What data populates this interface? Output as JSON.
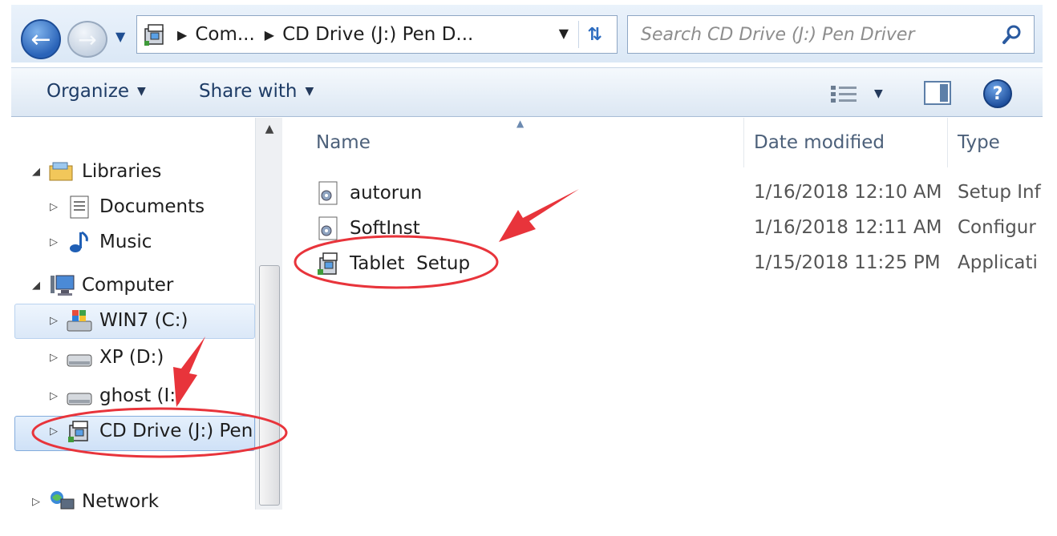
{
  "address_bar": {
    "crumbs": [
      "Com...",
      "CD Drive (J:) Pen D..."
    ],
    "search_placeholder": "Search CD Drive (J:) Pen Driver"
  },
  "toolbar": {
    "organize_label": "Organize",
    "share_label": "Share with"
  },
  "nav_pane": {
    "items": [
      {
        "label": "Libraries",
        "icon": "libraries-icon"
      },
      {
        "label": "Documents",
        "icon": "documents-icon"
      },
      {
        "label": "Music",
        "icon": "music-icon"
      },
      {
        "label": "Computer",
        "icon": "computer-icon"
      },
      {
        "label": "WIN7 (C:)",
        "icon": "windows-drive-icon"
      },
      {
        "label": "XP (D:)",
        "icon": "hard-drive-icon"
      },
      {
        "label": "ghost (I:)",
        "icon": "hard-drive-icon"
      },
      {
        "label": "CD Drive (J:) Pen",
        "icon": "cd-drive-icon"
      },
      {
        "label": "Network",
        "icon": "network-icon"
      }
    ]
  },
  "file_list": {
    "columns": [
      "Name",
      "Date modified",
      "Type"
    ],
    "rows": [
      {
        "name": "autorun",
        "date": "1/16/2018 12:10 AM",
        "type": "Setup Inf",
        "icon": "settings-file-icon"
      },
      {
        "name": "SoftInst",
        "date": "1/16/2018 12:11 AM",
        "type": "Configur",
        "icon": "settings-file-icon"
      },
      {
        "name": "Tablet  Setup",
        "date": "1/15/2018 11:25 PM",
        "type": "Applicati",
        "icon": "setup-app-icon"
      }
    ]
  },
  "colors": {
    "annotation_red": "#e8343b",
    "accent_blue": "#2a63b8",
    "selection_blue": "#cfe1f7"
  }
}
